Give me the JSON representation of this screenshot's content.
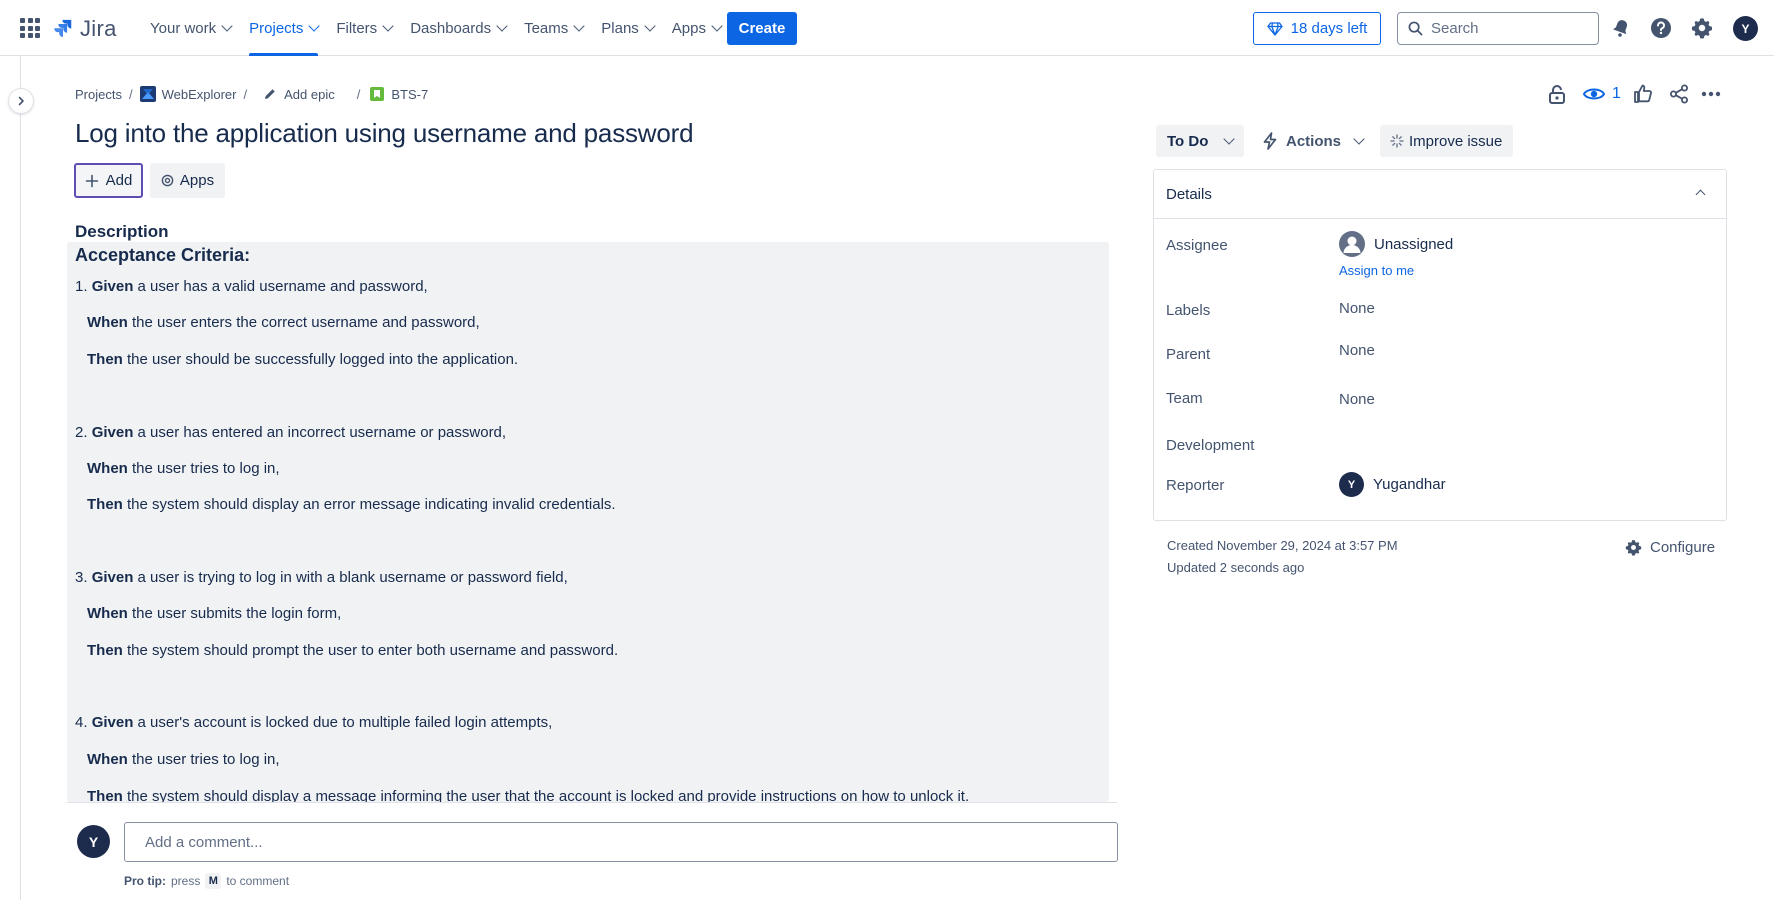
{
  "topnav": {
    "logo_text": "Jira",
    "items": [
      {
        "label": "Your work"
      },
      {
        "label": "Projects"
      },
      {
        "label": "Filters"
      },
      {
        "label": "Dashboards"
      },
      {
        "label": "Teams"
      },
      {
        "label": "Plans"
      },
      {
        "label": "Apps"
      }
    ],
    "active_item": "Projects",
    "create_label": "Create",
    "trial_label": "18 days left",
    "search_placeholder": "Search",
    "avatar_initial": "Y"
  },
  "breadcrumb": {
    "projects": "Projects",
    "project": "WebExplorer",
    "epic": "Add epic",
    "issue_key": "BTS-7"
  },
  "issue": {
    "title": "Log into the application using username and password",
    "add_label": "Add",
    "apps_label": "Apps",
    "description_heading": "Description",
    "acceptance_title": "Acceptance Criteria:",
    "criteria": [
      {
        "given_prefix": "1. ",
        "given_kw": "Given",
        "given_text": " a user has a valid username and password,",
        "when_kw": "When",
        "when_text": " the user enters the correct username and password,",
        "then_kw": "Then",
        "then_text": " the user should be successfully logged into the application."
      },
      {
        "given_prefix": "2. ",
        "given_kw": "Given",
        "given_text": " a user has entered an incorrect username or password,",
        "when_kw": "When",
        "when_text": " the user tries to log in,",
        "then_kw": "Then",
        "then_text": " the system should display an error message indicating invalid credentials."
      },
      {
        "given_prefix": "3. ",
        "given_kw": "Given",
        "given_text": " a user is trying to log in with a blank username or password field,",
        "when_kw": "When",
        "when_text": " the user submits the login form,",
        "then_kw": "Then",
        "then_text": " the system should prompt the user to enter both username and password."
      },
      {
        "given_prefix": "4. ",
        "given_kw": "Given",
        "given_text": " a user's account is locked due to multiple failed login attempts,",
        "when_kw": "When",
        "when_text": " the user tries to log in,",
        "then_kw": "Then",
        "then_text": " the system should display a message informing the user that the account is locked and provide instructions on how to unlock it."
      }
    ]
  },
  "comment": {
    "avatar_initial": "Y",
    "placeholder": "Add a comment...",
    "protip_label": "Pro tip:",
    "protip_press": "press",
    "protip_key": "M",
    "protip_suffix": "to comment"
  },
  "header_actions": {
    "watch_count": "1"
  },
  "sidebar": {
    "status_label": "To Do",
    "actions_label": "Actions",
    "improve_label": "Improve issue",
    "details_title": "Details",
    "fields": {
      "assignee_label": "Assignee",
      "assignee_value": "Unassigned",
      "assign_to_me": "Assign to me",
      "labels_label": "Labels",
      "labels_value": "None",
      "parent_label": "Parent",
      "parent_value": "None",
      "team_label": "Team",
      "team_value": "None",
      "development_label": "Development",
      "reporter_label": "Reporter",
      "reporter_initial": "Y",
      "reporter_value": "Yugandhar"
    },
    "created": "Created November 29, 2024 at 3:57 PM",
    "updated": "Updated 2 seconds ago",
    "configure_label": "Configure"
  },
  "colors": {
    "brand_blue": "#0c66e4",
    "text": "#172b4d",
    "subtle_text": "#44546f",
    "panel_bg": "#f1f2f4"
  }
}
